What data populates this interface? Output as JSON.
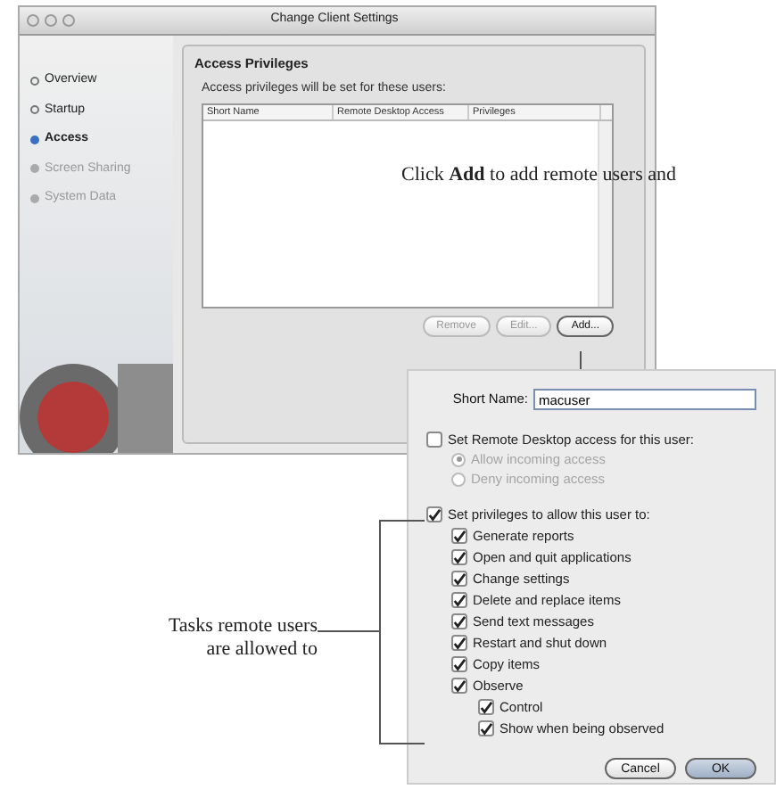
{
  "window": {
    "title": "Change Client Settings",
    "sidebar": {
      "items": [
        {
          "label": "Overview",
          "selected": false,
          "disabled": false
        },
        {
          "label": "Startup",
          "selected": false,
          "disabled": false
        },
        {
          "label": "Access",
          "selected": true,
          "disabled": false
        },
        {
          "label": "Screen Sharing",
          "selected": false,
          "disabled": true
        },
        {
          "label": "System Data",
          "selected": false,
          "disabled": true
        }
      ]
    },
    "section_title": "Access Privileges",
    "table_caption": "Access privileges will be set for these users:",
    "table": {
      "columns": [
        "Short Name",
        "Remote Desktop Access",
        "Privileges"
      ]
    },
    "buttons": [
      {
        "label": "Remove",
        "disabled": true
      },
      {
        "label": "Edit...",
        "disabled": true
      },
      {
        "label": "Add...",
        "disabled": false
      }
    ]
  },
  "dialog": {
    "short_name_label": "Short Name:",
    "short_name_value": "macuser",
    "remote_access": {
      "label": "Set Remote Desktop access for this user:",
      "checked": false,
      "options": [
        {
          "label": "Allow incoming access",
          "selected": true,
          "disabled": true
        },
        {
          "label": "Deny incoming access",
          "selected": false,
          "disabled": true
        }
      ]
    },
    "privileges": {
      "label": "Set privileges to allow this user to:",
      "checked": true,
      "items": [
        {
          "label": "Generate reports",
          "checked": true
        },
        {
          "label": "Open and quit applications",
          "checked": true
        },
        {
          "label": "Change settings",
          "checked": true
        },
        {
          "label": "Delete and replace items",
          "checked": true
        },
        {
          "label": "Send text messages",
          "checked": true
        },
        {
          "label": "Restart and shut down",
          "checked": true
        },
        {
          "label": "Copy items",
          "checked": true
        },
        {
          "label": "Observe",
          "checked": true,
          "children": [
            {
              "label": "Control",
              "checked": true
            },
            {
              "label": "Show when being observed",
              "checked": true
            }
          ]
        }
      ]
    },
    "buttons": [
      {
        "label": "Cancel",
        "default": false
      },
      {
        "label": "OK",
        "default": true
      }
    ]
  },
  "callouts": [
    {
      "text": "Click **Add** to add remote users and"
    },
    {
      "text": "Tasks remote users are allowed to"
    }
  ]
}
